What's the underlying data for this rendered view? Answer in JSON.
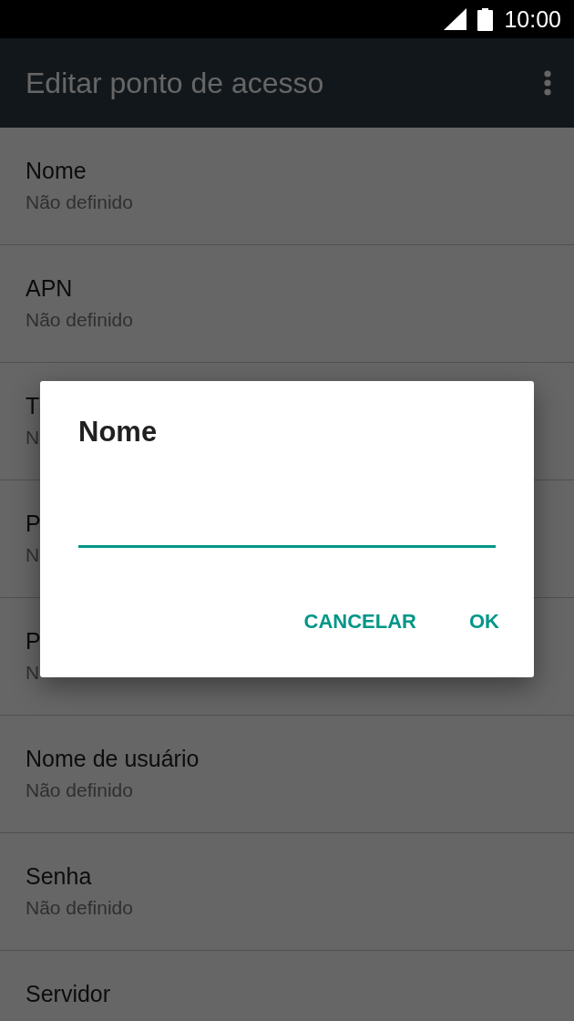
{
  "status_bar": {
    "time": "10:00"
  },
  "app_bar": {
    "title": "Editar ponto de acesso"
  },
  "settings": [
    {
      "title": "Nome",
      "summary": "Não definido"
    },
    {
      "title": "APN",
      "summary": "Não definido"
    },
    {
      "title": "T",
      "summary": "N"
    },
    {
      "title": "P",
      "summary": "N"
    },
    {
      "title": "P",
      "summary": "N"
    },
    {
      "title": "Nome de usuário",
      "summary": "Não definido"
    },
    {
      "title": "Senha",
      "summary": "Não definido"
    },
    {
      "title": "Servidor"
    }
  ],
  "dialog": {
    "title": "Nome",
    "buttons": [
      "CANCELAR",
      "OK"
    ]
  }
}
